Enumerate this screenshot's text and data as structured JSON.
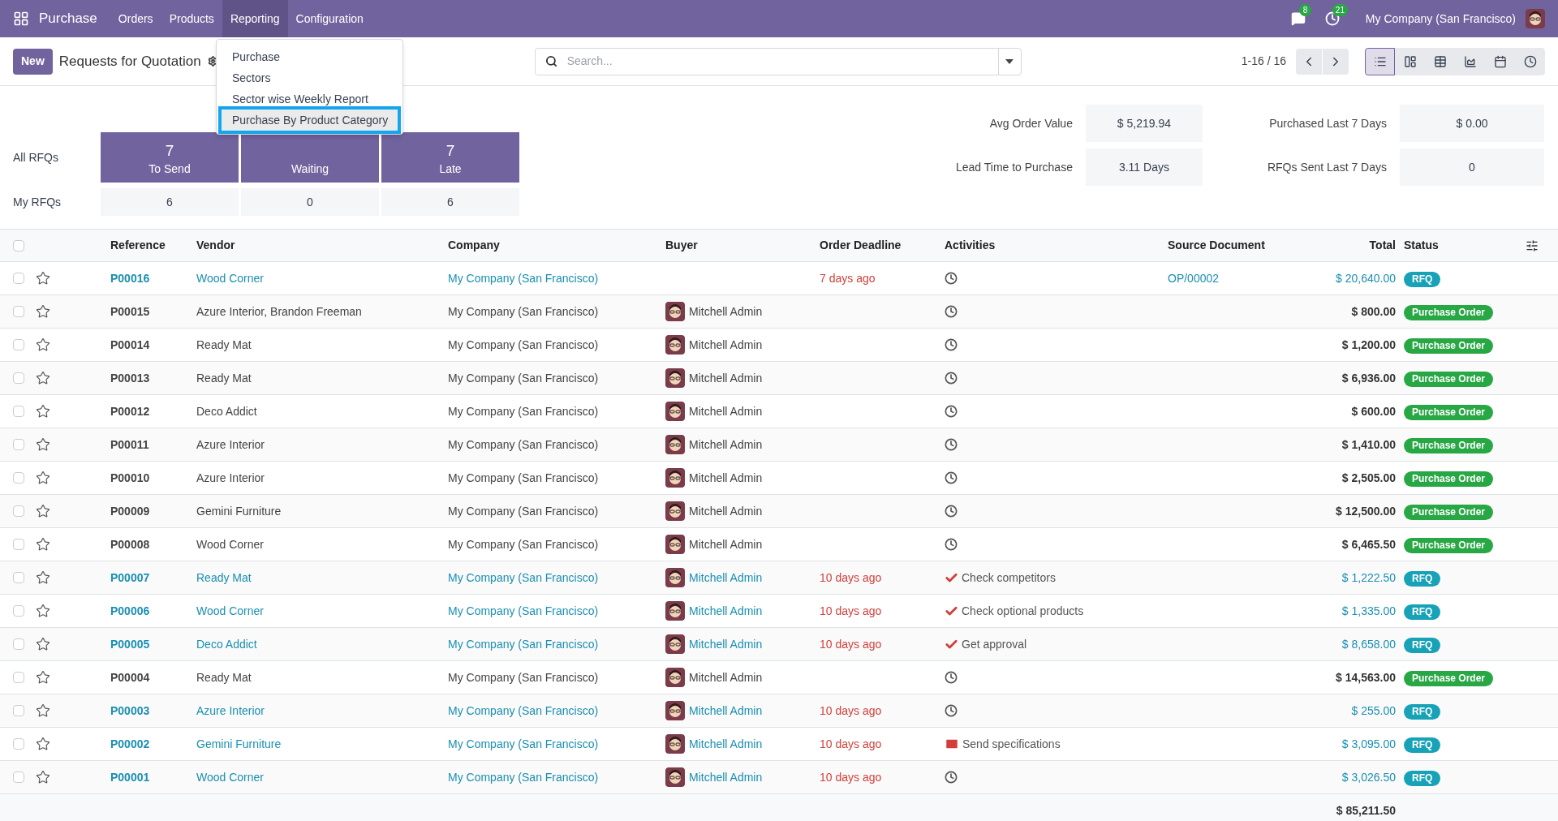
{
  "navbar": {
    "app": "Purchase",
    "menus": [
      {
        "label": "Orders",
        "selected": false
      },
      {
        "label": "Products",
        "selected": false
      },
      {
        "label": "Reporting",
        "selected": true
      },
      {
        "label": "Configuration",
        "selected": false
      }
    ],
    "messages_count": "8",
    "activities_count": "21",
    "company": "My Company (San Francisco)"
  },
  "reporting_menu": [
    {
      "label": "Purchase",
      "selected": false
    },
    {
      "label": "Sectors",
      "selected": false
    },
    {
      "label": "Sector wise Weekly Report",
      "selected": false
    },
    {
      "label": "Purchase By Product Category",
      "selected": true
    }
  ],
  "control_panel": {
    "new_button": "New",
    "title": "Requests for Quotation",
    "search": {
      "placeholder": "Search..."
    },
    "pager": "1-16 / 16",
    "views": [
      {
        "kind": "list",
        "selected": true
      },
      {
        "kind": "kanban",
        "selected": false
      },
      {
        "kind": "pivot",
        "selected": false
      },
      {
        "kind": "graph",
        "selected": false
      },
      {
        "kind": "calendar",
        "selected": false
      },
      {
        "kind": "activity",
        "selected": false
      }
    ]
  },
  "dashboard": {
    "row_labels": [
      "All RFQs",
      "My RFQs"
    ],
    "cards": [
      {
        "count": "7",
        "label": "To Send",
        "mine": "6"
      },
      {
        "label": "Waiting",
        "mine": "0"
      },
      {
        "count": "7",
        "label": "Late",
        "mine": "6"
      }
    ],
    "stats": [
      {
        "label": "Avg Order Value",
        "value": "$ 5,219.94"
      },
      {
        "label": "Purchased Last 7 Days",
        "value": "$ 0.00"
      },
      {
        "label": "Lead Time to Purchase",
        "value": "3.11 Days"
      },
      {
        "label": "RFQs Sent Last 7 Days",
        "value": "0"
      }
    ]
  },
  "table": {
    "select_all_checked": false,
    "columns": [
      "Reference",
      "Vendor",
      "Company",
      "Buyer",
      "Order Deadline",
      "Activities",
      "Source Document",
      "Total",
      "Status"
    ],
    "rows": [
      {
        "checked": false,
        "reference": "P00016",
        "vendor": "Wood Corner",
        "company": "My Company (San Francisco)",
        "deadline": "7 days ago",
        "activity": {
          "kind": "clock"
        },
        "source": "OP/00002",
        "total": "$ 20,640.00",
        "status": "RFQ",
        "kind": "rfq"
      },
      {
        "checked": false,
        "reference": "P00015",
        "vendor": "Azure Interior, Brandon Freeman",
        "company": "My Company (San Francisco)",
        "buyer": "Mitchell Admin",
        "activity": {
          "kind": "clock"
        },
        "total": "$ 800.00",
        "status": "Purchase Order",
        "kind": "po"
      },
      {
        "checked": false,
        "reference": "P00014",
        "vendor": "Ready Mat",
        "company": "My Company (San Francisco)",
        "buyer": "Mitchell Admin",
        "activity": {
          "kind": "clock"
        },
        "total": "$ 1,200.00",
        "status": "Purchase Order",
        "kind": "po"
      },
      {
        "checked": false,
        "reference": "P00013",
        "vendor": "Ready Mat",
        "company": "My Company (San Francisco)",
        "buyer": "Mitchell Admin",
        "activity": {
          "kind": "clock"
        },
        "total": "$ 6,936.00",
        "status": "Purchase Order",
        "kind": "po"
      },
      {
        "checked": false,
        "reference": "P00012",
        "vendor": "Deco Addict",
        "company": "My Company (San Francisco)",
        "buyer": "Mitchell Admin",
        "activity": {
          "kind": "clock"
        },
        "total": "$ 600.00",
        "status": "Purchase Order",
        "kind": "po"
      },
      {
        "checked": false,
        "reference": "P00011",
        "vendor": "Azure Interior",
        "company": "My Company (San Francisco)",
        "buyer": "Mitchell Admin",
        "activity": {
          "kind": "clock"
        },
        "total": "$ 1,410.00",
        "status": "Purchase Order",
        "kind": "po"
      },
      {
        "checked": false,
        "reference": "P00010",
        "vendor": "Azure Interior",
        "company": "My Company (San Francisco)",
        "buyer": "Mitchell Admin",
        "activity": {
          "kind": "clock"
        },
        "total": "$ 2,505.00",
        "status": "Purchase Order",
        "kind": "po"
      },
      {
        "checked": false,
        "reference": "P00009",
        "vendor": "Gemini Furniture",
        "company": "My Company (San Francisco)",
        "buyer": "Mitchell Admin",
        "activity": {
          "kind": "clock"
        },
        "total": "$ 12,500.00",
        "status": "Purchase Order",
        "kind": "po"
      },
      {
        "checked": false,
        "reference": "P00008",
        "vendor": "Wood Corner",
        "company": "My Company (San Francisco)",
        "buyer": "Mitchell Admin",
        "activity": {
          "kind": "clock"
        },
        "total": "$ 6,465.50",
        "status": "Purchase Order",
        "kind": "po"
      },
      {
        "checked": false,
        "reference": "P00007",
        "vendor": "Ready Mat",
        "company": "My Company (San Francisco)",
        "buyer": "Mitchell Admin",
        "deadline": "10 days ago",
        "activity": {
          "kind": "check",
          "text": "Check competitors"
        },
        "total": "$ 1,222.50",
        "status": "RFQ",
        "kind": "rfq"
      },
      {
        "checked": false,
        "reference": "P00006",
        "vendor": "Wood Corner",
        "company": "My Company (San Francisco)",
        "buyer": "Mitchell Admin",
        "deadline": "10 days ago",
        "activity": {
          "kind": "check",
          "text": "Check optional products"
        },
        "total": "$ 1,335.00",
        "status": "RFQ",
        "kind": "rfq"
      },
      {
        "checked": false,
        "reference": "P00005",
        "vendor": "Deco Addict",
        "company": "My Company (San Francisco)",
        "buyer": "Mitchell Admin",
        "deadline": "10 days ago",
        "activity": {
          "kind": "check",
          "text": "Get approval"
        },
        "total": "$ 8,658.00",
        "status": "RFQ",
        "kind": "rfq"
      },
      {
        "checked": false,
        "reference": "P00004",
        "vendor": "Ready Mat",
        "company": "My Company (San Francisco)",
        "buyer": "Mitchell Admin",
        "activity": {
          "kind": "clock"
        },
        "total": "$ 14,563.00",
        "status": "Purchase Order",
        "kind": "po"
      },
      {
        "checked": false,
        "reference": "P00003",
        "vendor": "Azure Interior",
        "company": "My Company (San Francisco)",
        "buyer": "Mitchell Admin",
        "deadline": "10 days ago",
        "activity": {
          "kind": "clock"
        },
        "total": "$ 255.00",
        "status": "RFQ",
        "kind": "rfq"
      },
      {
        "checked": false,
        "reference": "P00002",
        "vendor": "Gemini Furniture",
        "company": "My Company (San Francisco)",
        "buyer": "Mitchell Admin",
        "deadline": "10 days ago",
        "activity": {
          "kind": "mail",
          "text": "Send specifications"
        },
        "total": "$ 3,095.00",
        "status": "RFQ",
        "kind": "rfq"
      },
      {
        "checked": false,
        "reference": "P00001",
        "vendor": "Wood Corner",
        "company": "My Company (San Francisco)",
        "buyer": "Mitchell Admin",
        "deadline": "10 days ago",
        "activity": {
          "kind": "clock"
        },
        "total": "$ 3,026.50",
        "status": "RFQ",
        "kind": "rfq"
      }
    ],
    "grand_total": "$ 85,211.50"
  }
}
